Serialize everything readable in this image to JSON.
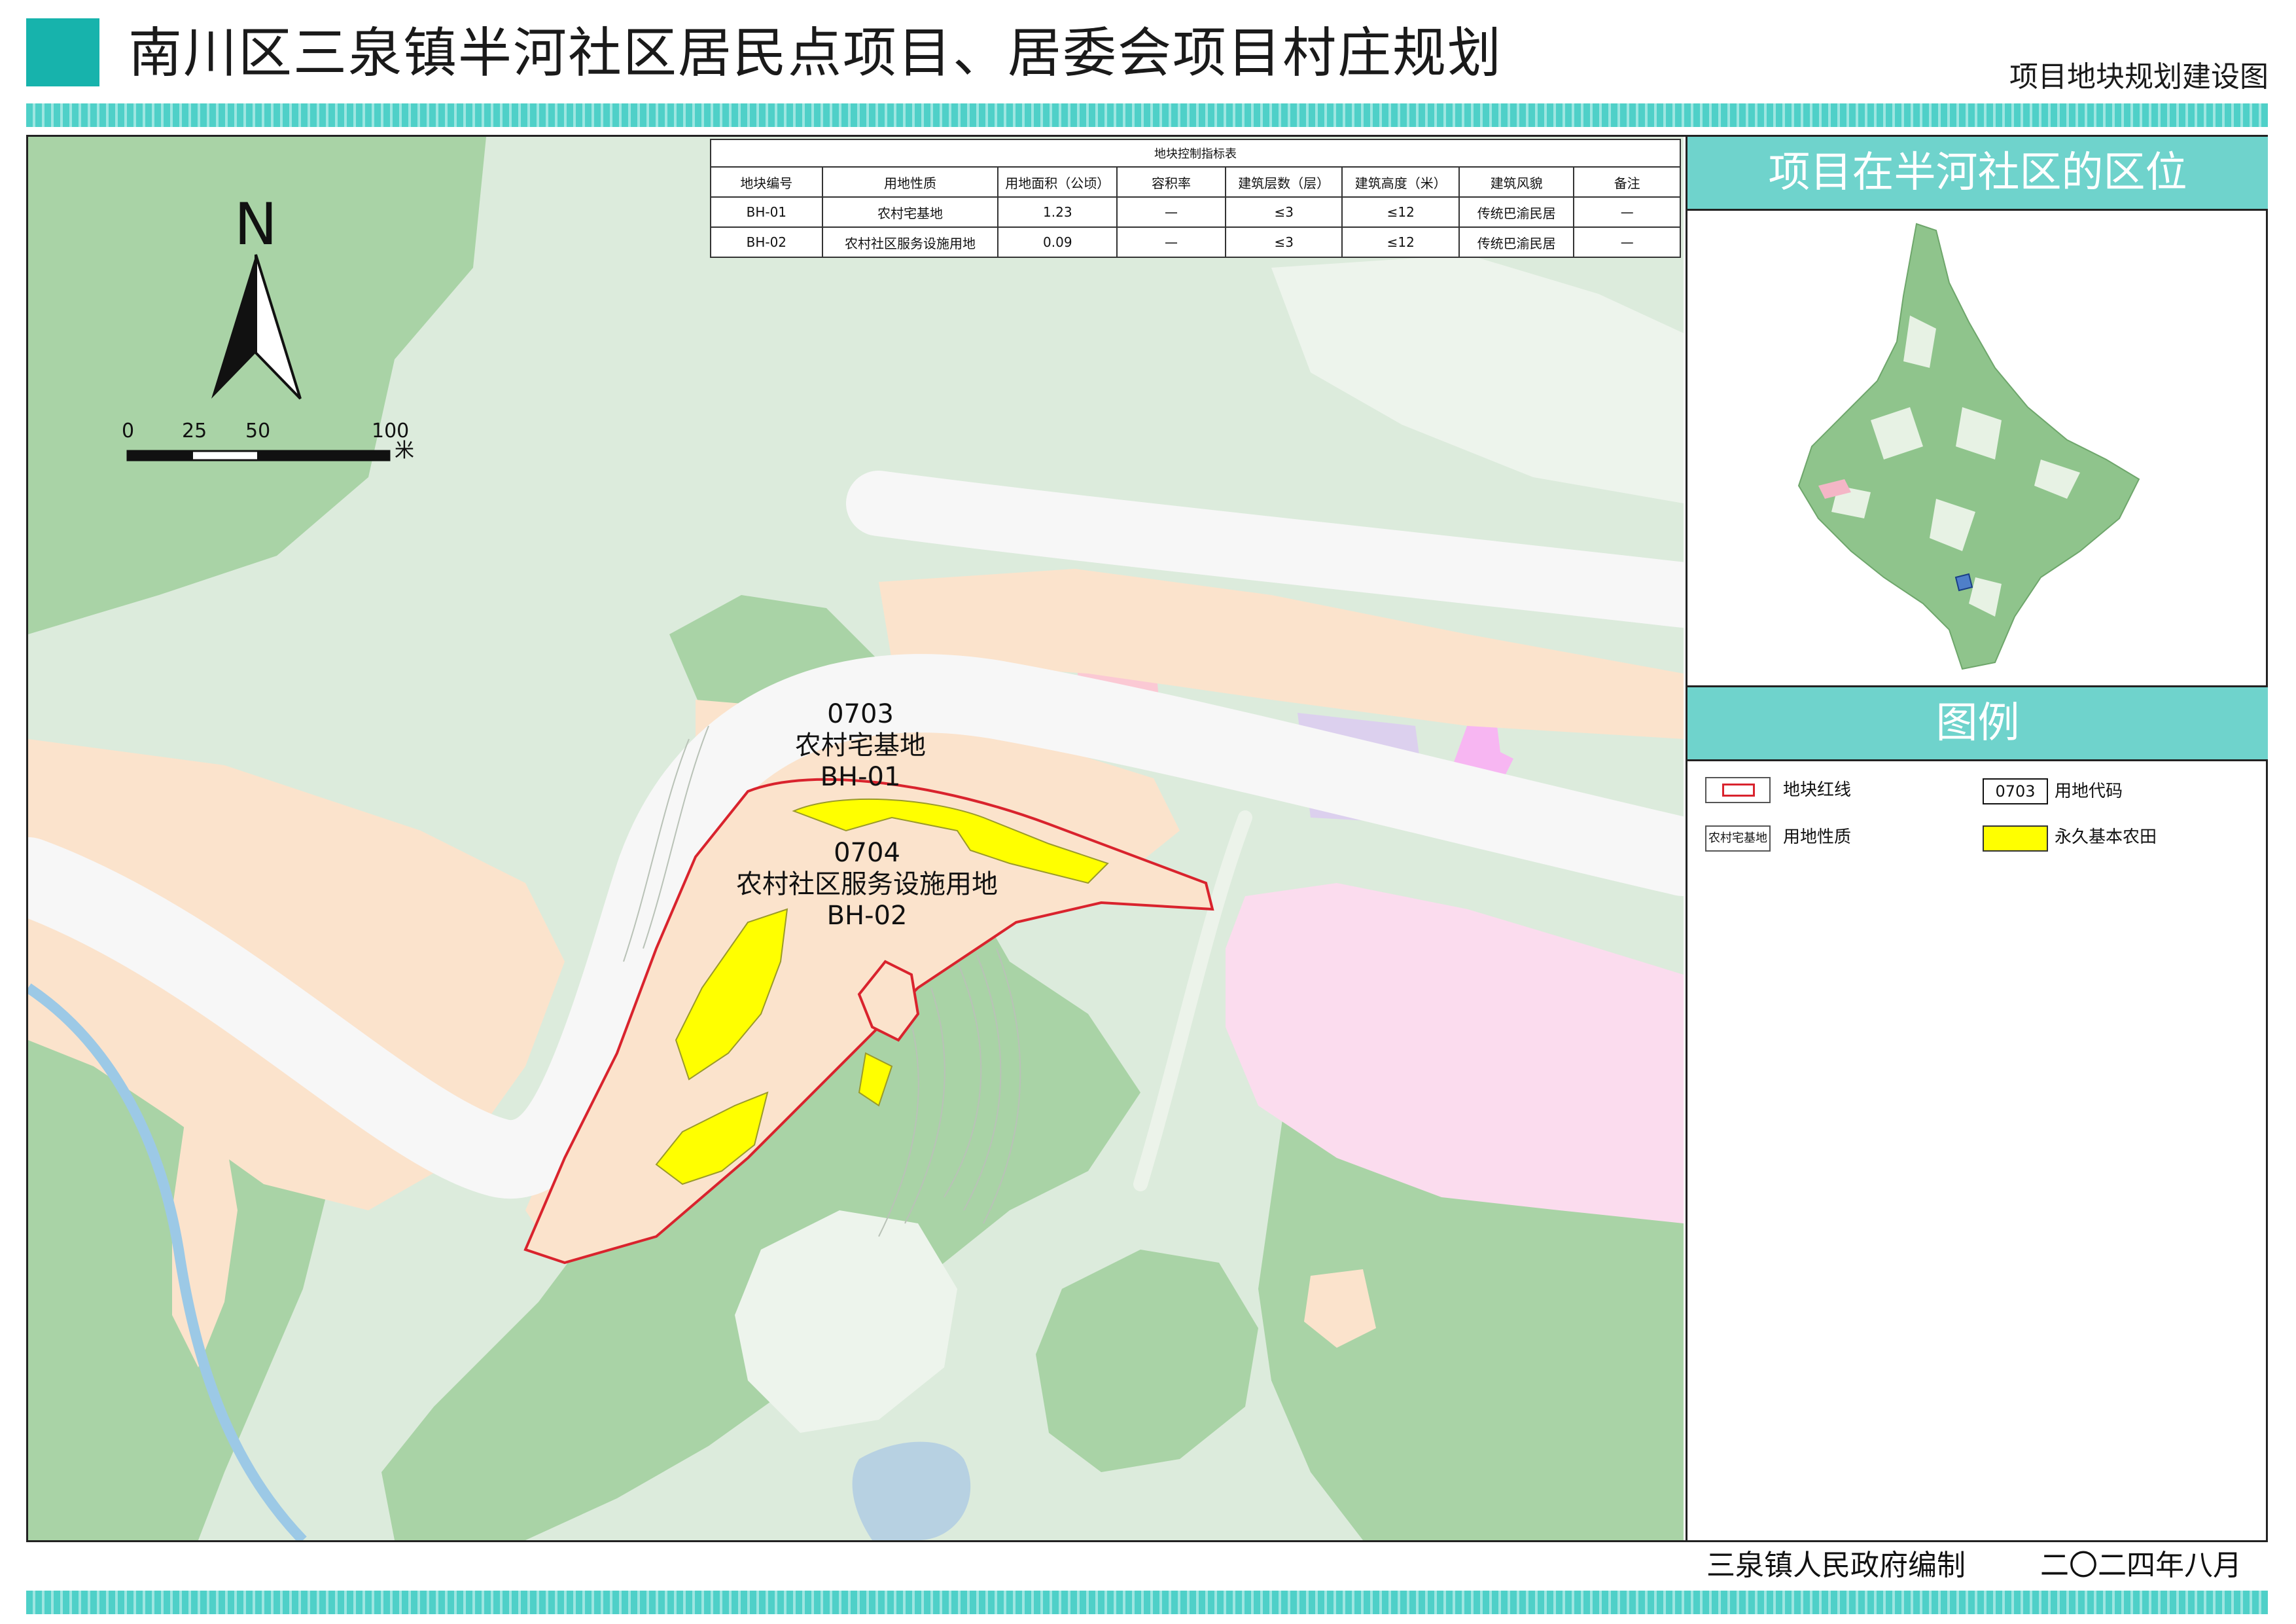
{
  "header": {
    "title": "南川区三泉镇半河社区居民点项目、居委会项目村庄规划",
    "subtitle": "项目地块规划建设图",
    "accent_color": "#17b3ac"
  },
  "control_table": {
    "caption": "地块控制指标表",
    "columns": [
      "地块编号",
      "用地性质",
      "用地面积（公顷）",
      "容积率",
      "建筑层数（层）",
      "建筑高度（米）",
      "建筑风貌",
      "备注"
    ],
    "rows": [
      [
        "BH-01",
        "农村宅基地",
        "1.23",
        "—",
        "≤3",
        "≤12",
        "传统巴渝民居",
        "—"
      ],
      [
        "BH-02",
        "农村社区服务设施用地",
        "0.09",
        "—",
        "≤3",
        "≤12",
        "传统巴渝民居",
        "—"
      ]
    ]
  },
  "map": {
    "north_label": "N",
    "scale_ticks": [
      "0",
      "25",
      "50",
      "100"
    ],
    "scale_unit": "米",
    "plots": [
      {
        "code": "0703",
        "use": "农村宅基地",
        "id": "BH-01"
      },
      {
        "code": "0704",
        "use": "农村社区服务设施用地",
        "id": "BH-02"
      }
    ],
    "colors": {
      "green_land": "#dcebdc",
      "forest": "#a9d3a6",
      "road": "#f7f7f7",
      "residential": "#fbe3cc",
      "farmland_yellow": "#ffff00",
      "redline": "#d9232d",
      "water": "#9cc9e6",
      "pink": "#fbdcee",
      "purple": "#dcd0ee",
      "magenta": "#f7b6f2"
    }
  },
  "sidebar": {
    "location_title": "项目在半河社区的区位",
    "legend_title": "图例",
    "legend": {
      "redline_label": "地块红线",
      "code_sample": "0703",
      "code_label": "用地代码",
      "use_sample": "农村宅基地",
      "use_label": "用地性质",
      "farmland_label": "永久基本农田"
    }
  },
  "footer": {
    "org": "三泉镇人民政府编制",
    "date": "二〇二四年八月"
  }
}
